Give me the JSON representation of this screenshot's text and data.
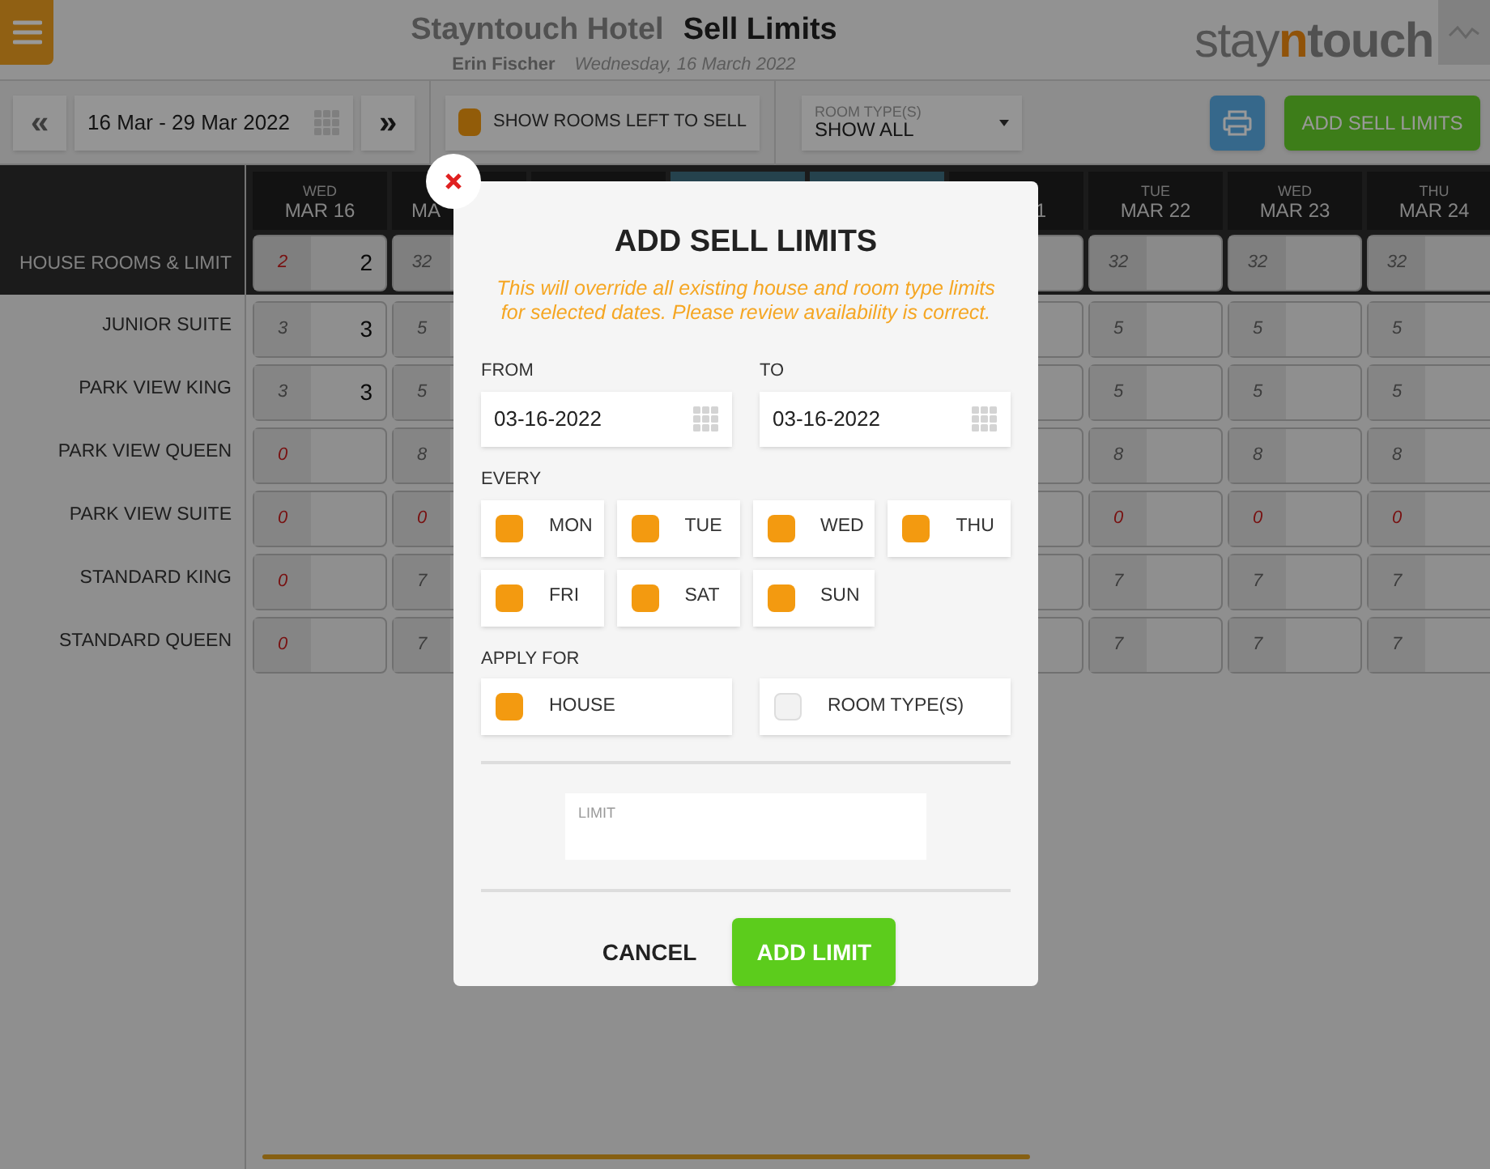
{
  "header": {
    "hotel": "Stayntouch Hotel",
    "title": "Sell Limits",
    "user": "Erin Fischer",
    "date": "Wednesday, 16 March 2022",
    "logo_parts": [
      "stay",
      "n",
      "touch"
    ]
  },
  "toolbar": {
    "prev": "«",
    "date_range": "16 Mar - 29 Mar 2022",
    "next": "»",
    "show_rooms": {
      "label": "SHOW ROOMS LEFT TO SELL",
      "checked": true
    },
    "room_type": {
      "label": "ROOM TYPE(S)",
      "value": "SHOW ALL"
    },
    "add_button": "ADD SELL LIMITS"
  },
  "columns": [
    {
      "kind": "full",
      "day": "WED",
      "date": "MAR 16",
      "weekend": false
    },
    {
      "kind": "cut_left",
      "date": "MA",
      "weekend": false
    },
    {
      "kind": "hidden",
      "weekend": false
    },
    {
      "kind": "hidden",
      "weekend": true
    },
    {
      "kind": "hidden",
      "weekend": true
    },
    {
      "kind": "cut_right",
      "date": "1",
      "weekend": false
    },
    {
      "kind": "full",
      "day": "TUE",
      "date": "MAR 22",
      "weekend": false
    },
    {
      "kind": "full",
      "day": "WED",
      "date": "MAR 23",
      "weekend": false
    },
    {
      "kind": "full",
      "day": "THU",
      "date": "MAR 24",
      "weekend": false
    }
  ],
  "rows": [
    {
      "label": "HOUSE ROOMS & LIMIT",
      "kind": "house",
      "cells": [
        {
          "available": "2",
          "alert": true,
          "limit": "2"
        },
        {
          "available": "32",
          "alert": false
        },
        {
          "available": "32",
          "alert": false
        },
        {
          "available": "32",
          "alert": false
        },
        {
          "available": "32",
          "alert": false
        }
      ]
    },
    {
      "label": "JUNIOR SUITE",
      "kind": "room",
      "cells": [
        {
          "available": "3",
          "alert": false,
          "limit": "3"
        },
        {
          "available": "5",
          "alert": false
        },
        {
          "available": "5",
          "alert": false
        },
        {
          "available": "5",
          "alert": false
        },
        {
          "available": "5",
          "alert": false
        }
      ]
    },
    {
      "label": "PARK VIEW KING",
      "kind": "room",
      "cells": [
        {
          "available": "3",
          "alert": false,
          "limit": "3"
        },
        {
          "available": "5",
          "alert": false
        },
        {
          "available": "5",
          "alert": false
        },
        {
          "available": "5",
          "alert": false
        },
        {
          "available": "5",
          "alert": false
        }
      ]
    },
    {
      "label": "PARK VIEW QUEEN",
      "kind": "room",
      "cells": [
        {
          "available": "0",
          "alert": true
        },
        {
          "available": "8",
          "alert": false
        },
        {
          "available": "8",
          "alert": false
        },
        {
          "available": "8",
          "alert": false
        },
        {
          "available": "8",
          "alert": false
        }
      ]
    },
    {
      "label": "PARK VIEW SUITE",
      "kind": "room",
      "cells": [
        {
          "available": "0",
          "alert": true
        },
        {
          "available": "0",
          "alert": true
        },
        {
          "available": "0",
          "alert": true
        },
        {
          "available": "0",
          "alert": true
        },
        {
          "available": "0",
          "alert": true
        }
      ]
    },
    {
      "label": "STANDARD KING",
      "kind": "room",
      "cells": [
        {
          "available": "0",
          "alert": true
        },
        {
          "available": "7",
          "alert": false
        },
        {
          "available": "7",
          "alert": false
        },
        {
          "available": "7",
          "alert": false
        },
        {
          "available": "7",
          "alert": false
        }
      ]
    },
    {
      "label": "STANDARD QUEEN",
      "kind": "room",
      "cells": [
        {
          "available": "0",
          "alert": true
        },
        {
          "available": "7",
          "alert": false
        },
        {
          "available": "7",
          "alert": false
        },
        {
          "available": "7",
          "alert": false
        },
        {
          "available": "7",
          "alert": false
        }
      ]
    }
  ],
  "dialog": {
    "title": "ADD SELL LIMITS",
    "warning": "This will override all existing house and room type limits for selected dates. Please review availability is correct.",
    "from": {
      "label": "FROM",
      "value": "03-16-2022"
    },
    "to": {
      "label": "TO",
      "value": "03-16-2022"
    },
    "every": {
      "label": "EVERY",
      "days": [
        {
          "label": "MON",
          "checked": true
        },
        {
          "label": "TUE",
          "checked": true
        },
        {
          "label": "WED",
          "checked": true
        },
        {
          "label": "THU",
          "checked": true
        },
        {
          "label": "FRI",
          "checked": true
        },
        {
          "label": "SAT",
          "checked": true
        },
        {
          "label": "SUN",
          "checked": true
        }
      ]
    },
    "apply_for": {
      "label": "APPLY FOR",
      "options": [
        {
          "label": "HOUSE",
          "checked": true
        },
        {
          "label": "ROOM TYPE(S)",
          "checked": false
        }
      ]
    },
    "limit": {
      "placeholder": "LIMIT"
    },
    "cancel": "CANCEL",
    "submit": "ADD LIMIT"
  }
}
